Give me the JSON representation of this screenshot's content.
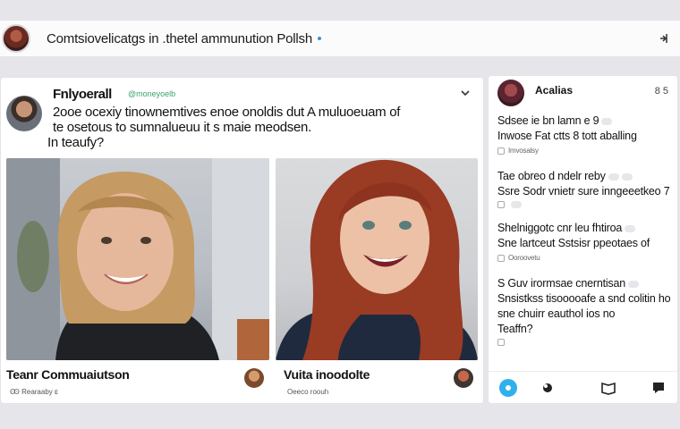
{
  "topbar": {
    "title": "Comtsiovelicatgs in .thetel ammunution Pollsh"
  },
  "post": {
    "author": "Fnlyoerall",
    "handle": "@moneyoelb",
    "body_line1": "2ooe ocexiy tinownemtives enoe onoldis dut A muluoeuam of",
    "body_line2": "te osetous to sumnalueuu it s maie meodsen.",
    "body_line3": "In teaufy?",
    "captions": [
      {
        "title": "Teanr Commuaiutson",
        "sub": "Ꙭ Rearaaby  ᴇ"
      },
      {
        "title": "Vuita inoodolte",
        "sub": "Oeeco roouh"
      }
    ]
  },
  "panel": {
    "title": "Acalias",
    "count": "8 5",
    "comments": [
      {
        "line1": "Sdsee ie bn lamn e 9",
        "line2": "Inwose Fat ctts 8 tott aballing",
        "meta": "Imvosalsy"
      },
      {
        "line1": "Tae obreo d ndelr reby",
        "line2": "Ssre Sodr vnietr sure inngeeetkeo",
        "extra": "7",
        "meta": ""
      },
      {
        "line1": "Shelniggotc cnr leu fhtiroa",
        "line2": "Sne lartceut Sstsisr ppeotaes of",
        "meta": "Ooroovetu"
      },
      {
        "line1": "S Guv irormsae cnerntisan",
        "line2": "Snsistkss tisooooafe a snd colitin ho",
        "line3": "sne chuirr eauthol ios no",
        "line4": "Teaffn?",
        "meta": ""
      }
    ]
  },
  "colors": {
    "accent": "#2fb1ec",
    "handle_green": "#3ca36b",
    "background": "#e6e6ea"
  }
}
